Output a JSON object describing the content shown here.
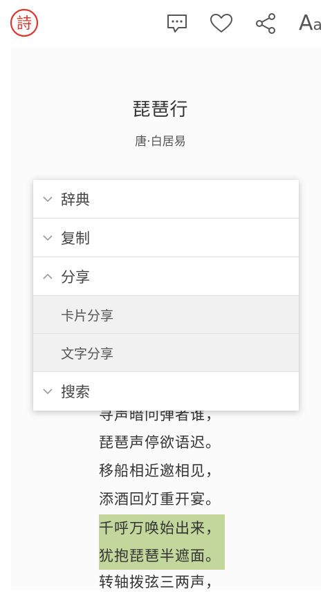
{
  "app": {
    "logo_char": "詩"
  },
  "toolbar": {
    "icons": [
      "comment-icon",
      "heart-icon",
      "share-icon",
      "font-size-icon"
    ],
    "font_big": "A",
    "font_small": "a",
    "icon_color": "#555555"
  },
  "poem": {
    "title": "琵琶行",
    "author": "唐·白居易",
    "lines": [
      "寻声暗问弹者谁，",
      "琵琶声停欲语迟。",
      "移船相近邀相见，",
      "添酒回灯重开宴。",
      "千呼万唤始出来，",
      "犹抱琵琶半遮面。",
      "转轴拨弦三两声，"
    ],
    "highlighted_lines": [
      4,
      5
    ],
    "highlight_color": "#c3d69b"
  },
  "menu": {
    "items": [
      {
        "label": "辞典",
        "expanded": false
      },
      {
        "label": "复制",
        "expanded": false
      },
      {
        "label": "分享",
        "expanded": true,
        "children": [
          "卡片分享",
          "文字分享"
        ]
      },
      {
        "label": "搜索",
        "expanded": false
      }
    ]
  },
  "colors": {
    "logo_red": "#d9382f",
    "text": "#333333",
    "divider": "#e3e3e3"
  }
}
